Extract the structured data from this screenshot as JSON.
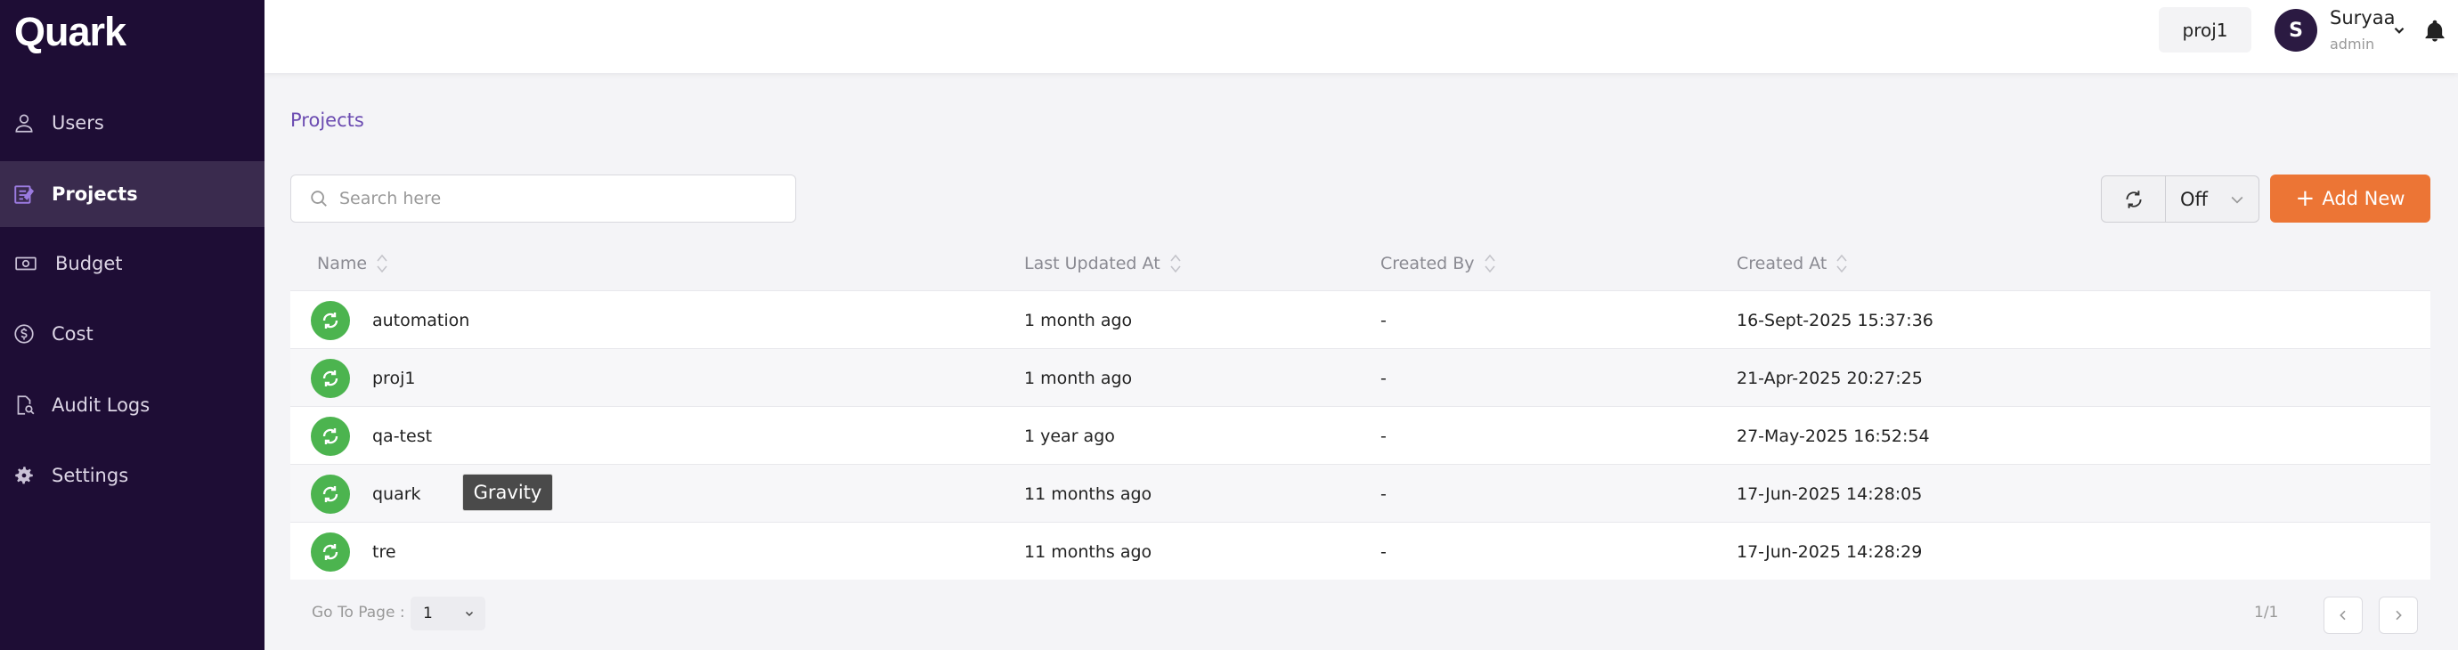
{
  "app": {
    "logo": "Quark"
  },
  "sidebar": {
    "items": [
      {
        "label": "Users",
        "icon": "user-icon",
        "active": false
      },
      {
        "label": "Projects",
        "icon": "projects-icon",
        "active": true
      },
      {
        "label": "Budget",
        "icon": "budget-icon",
        "active": false
      },
      {
        "label": "Cost",
        "icon": "cost-icon",
        "active": false
      },
      {
        "label": "Audit Logs",
        "icon": "audit-logs-icon",
        "active": false
      },
      {
        "label": "Settings",
        "icon": "gear-icon",
        "active": false
      }
    ]
  },
  "header": {
    "project_chip": "proj1",
    "user": {
      "initial": "S",
      "name": "Suryaa",
      "role": "admin"
    }
  },
  "breadcrumb": "Projects",
  "search": {
    "placeholder": "Search here",
    "value": ""
  },
  "refresh": {
    "interval": "Off"
  },
  "add_button": {
    "label": "Add New"
  },
  "table": {
    "columns": [
      "Name",
      "Last Updated At",
      "Created By",
      "Created At"
    ],
    "rows": [
      {
        "name": "automation",
        "last_updated": "1 month ago",
        "created_by": "-",
        "created_at": "16-Sept-2025 15:37:36"
      },
      {
        "name": "proj1",
        "last_updated": "1 month ago",
        "created_by": "-",
        "created_at": "21-Apr-2025 20:27:25"
      },
      {
        "name": "qa-test",
        "last_updated": "1 year ago",
        "created_by": "-",
        "created_at": "27-May-2025 16:52:54"
      },
      {
        "name": "quark",
        "last_updated": "11 months ago",
        "created_by": "-",
        "created_at": "17-Jun-2025 14:28:05"
      },
      {
        "name": "tre",
        "last_updated": "11 months ago",
        "created_by": "-",
        "created_at": "17-Jun-2025 14:28:29"
      }
    ]
  },
  "tooltip": "Gravity",
  "pagination": {
    "goto_label": "Go To Page :",
    "page": "1",
    "count": "1/1"
  },
  "colors": {
    "sidebar_bg": "#1e0d35",
    "accent": "#ec7535",
    "status_green": "#4cb44f",
    "link": "#6b4bb1"
  }
}
